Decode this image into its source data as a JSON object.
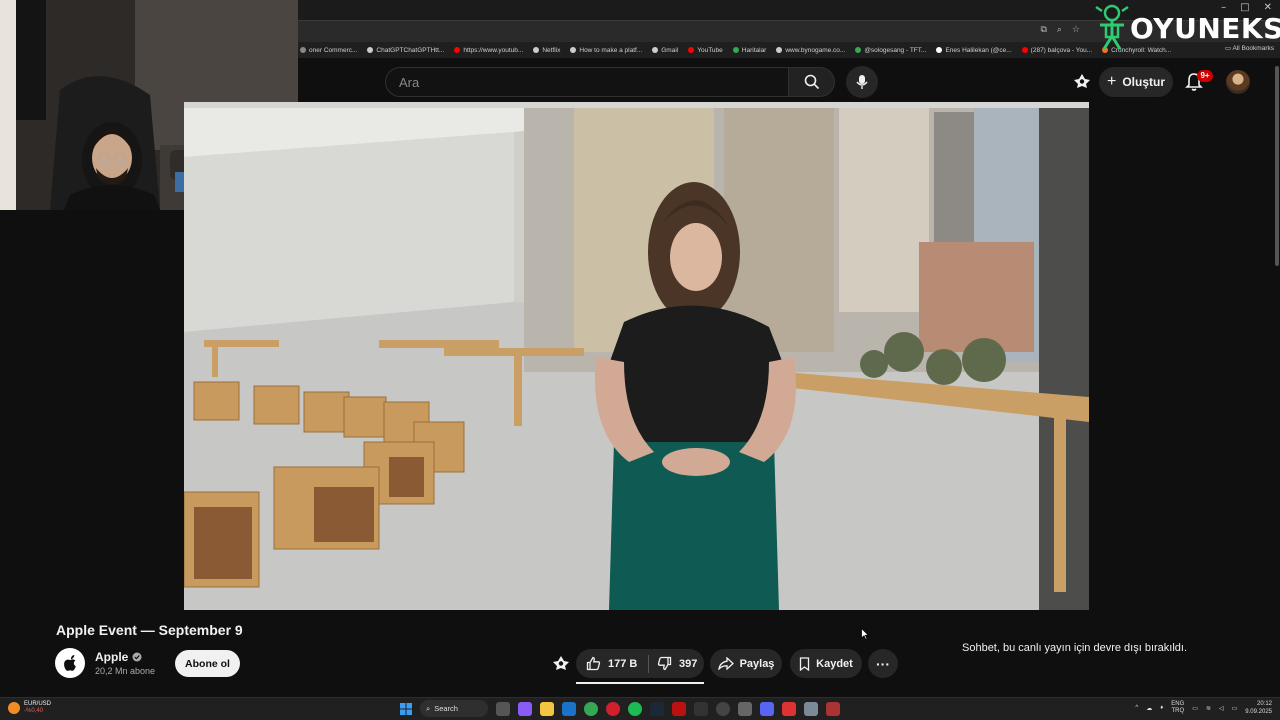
{
  "browser": {
    "window_controls": [
      "–",
      "□",
      "✕"
    ],
    "bookmarks": [
      {
        "label": "oner Commerc...",
        "color": "#888888"
      },
      {
        "label": "ChatGPTChatGPTHtt...",
        "color": "#cccccc"
      },
      {
        "label": "https://www.youtub...",
        "color": "#ff0000"
      },
      {
        "label": "Netflix",
        "color": "#cccccc"
      },
      {
        "label": "How to make a platf...",
        "color": "#cccccc"
      },
      {
        "label": "Gmail",
        "color": "#cccccc"
      },
      {
        "label": "YouTube",
        "color": "#ff0000"
      },
      {
        "label": "Haritalar",
        "color": "#34a853"
      },
      {
        "label": "www.bynogame.co...",
        "color": "#cccccc"
      },
      {
        "label": "@sologesang - TFT...",
        "color": "#34a853"
      },
      {
        "label": "Enes Halilekan (@ce...",
        "color": "#ffffff"
      },
      {
        "label": "(287) balçova - You...",
        "color": "#ff0000"
      },
      {
        "label": "Crunchyroll: Watch...",
        "color": "#f47521"
      }
    ],
    "all_bookmarks": "All Bookmarks"
  },
  "overlay_logo": {
    "text": "OYUNEKS",
    "color": "#2ecc71"
  },
  "header": {
    "search_placeholder": "Ara",
    "create_label": "Oluştur",
    "notification_count": "9+"
  },
  "video": {
    "title": "Apple Event — September 9"
  },
  "channel": {
    "name": "Apple",
    "subscribers": "20,2 Mn abone",
    "subscribe_label": "Abone ol"
  },
  "actions": {
    "likes": "177 B",
    "dislikes": "397",
    "share_label": "Paylaş",
    "save_label": "Kaydet"
  },
  "chat": {
    "disabled_message": "Sohbet, bu canlı yayın için devre dışı bırakıldı."
  },
  "taskbar": {
    "widget_title": "EUR/USD",
    "widget_value": "-%0,40",
    "search_label": "Search",
    "lang_top": "ENG",
    "lang_bottom": "TRQ",
    "time": "20:12",
    "date": "9.09.2025"
  },
  "colors": {
    "background": "#0f0f0f",
    "accent_red": "#cc0000",
    "button_bg": "#272727"
  }
}
